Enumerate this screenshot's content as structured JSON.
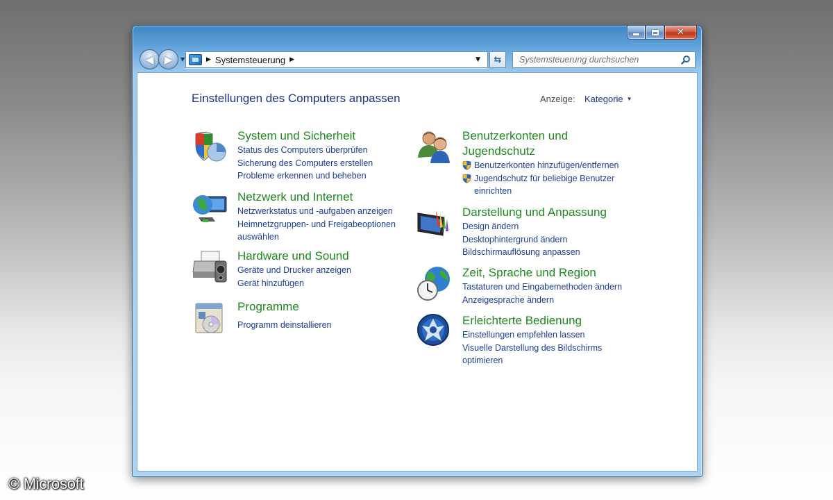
{
  "window": {
    "breadcrumb": "Systemsteuerung",
    "search_placeholder": "Systemsteuerung durchsuchen"
  },
  "page": {
    "title": "Einstellungen des Computers anpassen",
    "view_label": "Anzeige:",
    "view_value": "Kategorie"
  },
  "categories": [
    {
      "title": "System und Sicherheit",
      "icon": "shield-chart-icon",
      "links": [
        "Status des Computers überprüfen",
        "Sicherung des Computers erstellen",
        "Probleme erkennen und beheben"
      ]
    },
    {
      "title": "Netzwerk und Internet",
      "icon": "globe-monitor-icon",
      "links": [
        "Netzwerkstatus und -aufgaben anzeigen",
        "Heimnetzgruppen- und Freigabeoptionen",
        "auswählen"
      ]
    },
    {
      "title": "Hardware und Sound",
      "icon": "printer-speaker-icon",
      "links": [
        "Geräte und Drucker anzeigen",
        "Gerät hinzufügen"
      ]
    },
    {
      "title": "Programme",
      "icon": "programs-disc-icon",
      "links": [
        "Programm deinstallieren"
      ]
    },
    {
      "title_line1": "Benutzerkonten und",
      "title_line2": "Jugendschutz",
      "icon": "users-icon",
      "links": [
        "Benutzerkonten hinzufügen/entfernen",
        "Jugendschutz für beliebige Benutzer",
        "einrichten"
      ]
    },
    {
      "title": "Darstellung und Anpassung",
      "icon": "monitor-palette-icon",
      "links": [
        "Design ändern",
        "Desktophintergrund ändern",
        "Bildschirmauflösung anpassen"
      ]
    },
    {
      "title": "Zeit, Sprache und Region",
      "icon": "globe-clock-icon",
      "links": [
        "Tastaturen und Eingabemethoden ändern",
        "Anzeigesprache ändern"
      ]
    },
    {
      "title": "Erleichterte Bedienung",
      "icon": "ease-of-access-icon",
      "links": [
        "Einstellungen empfehlen lassen",
        "Visuelle Darstellung des Bildschirms",
        "optimieren"
      ]
    }
  ],
  "copyright": "© Microsoft"
}
